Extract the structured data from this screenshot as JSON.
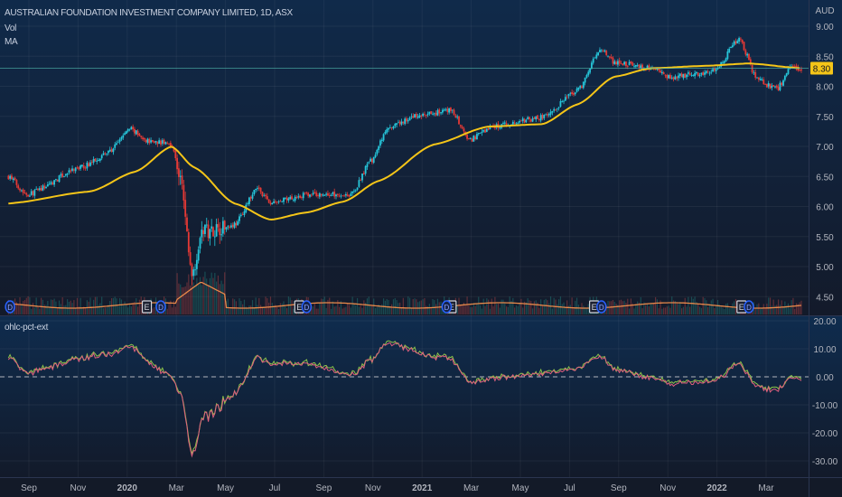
{
  "header": {
    "title": "AUSTRALIAN FOUNDATION INVESTMENT COMPANY LIMITED, 1D, ASX",
    "vol_label": "Vol",
    "ma_label": "MA"
  },
  "oscillator": {
    "label": "ohlc-pct-ext"
  },
  "colors": {
    "up": "#26c6da",
    "down": "#e53935",
    "ma": "#f5c518",
    "vol_ma": "#e8894a",
    "osc_a": "#8bc34a",
    "osc_b": "#e0607e",
    "last_price_bg": "#f5c518"
  },
  "chart_data": {
    "type": "candlestick",
    "title": "AUSTRALIAN FOUNDATION INVESTMENT COMPANY LIMITED, 1D, ASX",
    "currency": "AUD",
    "last_price": "8.30",
    "price_ticks": [
      "9.00",
      "8.50",
      "8.00",
      "7.50",
      "7.00",
      "6.50",
      "6.00",
      "5.50",
      "5.00",
      "4.50"
    ],
    "price_range": [
      4.5,
      9.0
    ],
    "close_path": [
      [
        "2019-08-06",
        6.5
      ],
      [
        "2019-08-29",
        6.2
      ],
      [
        "2019-11-05",
        6.65
      ],
      [
        "2019-12-08",
        6.9
      ],
      [
        "2020-01-05",
        7.3
      ],
      [
        "2020-01-22",
        7.1
      ],
      [
        "2020-02-25",
        7.05
      ],
      [
        "2020-03-06",
        6.45
      ],
      [
        "2020-03-20",
        4.9
      ],
      [
        "2020-04-03",
        5.6
      ],
      [
        "2020-05-12",
        5.7
      ],
      [
        "2020-06-10",
        6.3
      ],
      [
        "2020-06-26",
        6.05
      ],
      [
        "2020-08-10",
        6.2
      ],
      [
        "2020-10-05",
        6.2
      ],
      [
        "2020-10-28",
        6.75
      ],
      [
        "2020-11-20",
        7.3
      ],
      [
        "2020-12-23",
        7.5
      ],
      [
        "2021-02-07",
        7.6
      ],
      [
        "2021-02-28",
        7.1
      ],
      [
        "2021-03-27",
        7.33
      ],
      [
        "2021-05-28",
        7.48
      ],
      [
        "2021-07-11",
        7.93
      ],
      [
        "2021-08-09",
        8.62
      ],
      [
        "2021-08-26",
        8.4
      ],
      [
        "2021-10-10",
        8.3
      ],
      [
        "2021-11-01",
        8.15
      ],
      [
        "2021-12-27",
        8.25
      ],
      [
        "2022-01-28",
        8.78
      ],
      [
        "2022-02-21",
        8.1
      ],
      [
        "2022-03-14",
        7.95
      ],
      [
        "2022-03-31",
        8.3
      ],
      [
        "2022-04-15",
        8.3
      ]
    ],
    "ma_path": [
      [
        "2019-08-06",
        6.05
      ],
      [
        "2019-11-16",
        6.25
      ],
      [
        "2020-01-11",
        6.58
      ],
      [
        "2020-02-25",
        7.0
      ],
      [
        "2020-03-23",
        6.65
      ],
      [
        "2020-05-12",
        6.05
      ],
      [
        "2020-06-26",
        5.78
      ],
      [
        "2020-08-10",
        5.9
      ],
      [
        "2020-09-25",
        6.08
      ],
      [
        "2020-11-09",
        6.43
      ],
      [
        "2021-01-15",
        7.03
      ],
      [
        "2021-03-22",
        7.33
      ],
      [
        "2021-05-28",
        7.37
      ],
      [
        "2021-07-11",
        7.7
      ],
      [
        "2021-08-26",
        8.16
      ],
      [
        "2021-10-10",
        8.3
      ],
      [
        "2021-12-16",
        8.34
      ],
      [
        "2022-02-10",
        8.38
      ],
      [
        "2022-04-15",
        8.3
      ]
    ],
    "events": {
      "earnings": [
        "2020-01-25",
        "2020-07-31",
        "2021-02-07",
        "2021-07-31",
        "2022-01-31"
      ],
      "dividends": [
        "2019-08-08",
        "2020-02-12",
        "2020-08-10",
        "2021-02-01",
        "2021-08-10",
        "2022-02-10"
      ],
      "earnings_label": "E",
      "dividend_label": "D"
    },
    "oscillator": {
      "name": "ohlc-pct-ext",
      "ticks": [
        "20.00",
        "10.00",
        "0.00",
        "-10.00",
        "-20.00",
        "-30.00"
      ],
      "range": [
        -33,
        21
      ],
      "zero_line": 0
    },
    "x_ticks": [
      [
        "2019-09-01",
        "Sep"
      ],
      [
        "2019-11-01",
        "Nov"
      ],
      [
        "2020-01-01",
        "2020"
      ],
      [
        "2020-03-01",
        "Mar"
      ],
      [
        "2020-05-01",
        "May"
      ],
      [
        "2020-07-01",
        "Jul"
      ],
      [
        "2020-09-01",
        "Sep"
      ],
      [
        "2020-11-01",
        "Nov"
      ],
      [
        "2021-01-01",
        "2021"
      ],
      [
        "2021-03-01",
        "Mar"
      ],
      [
        "2021-05-01",
        "May"
      ],
      [
        "2021-07-01",
        "Jul"
      ],
      [
        "2021-09-01",
        "Sep"
      ],
      [
        "2021-11-01",
        "Nov"
      ],
      [
        "2022-01-01",
        "2022"
      ],
      [
        "2022-03-01",
        "Mar"
      ]
    ]
  }
}
